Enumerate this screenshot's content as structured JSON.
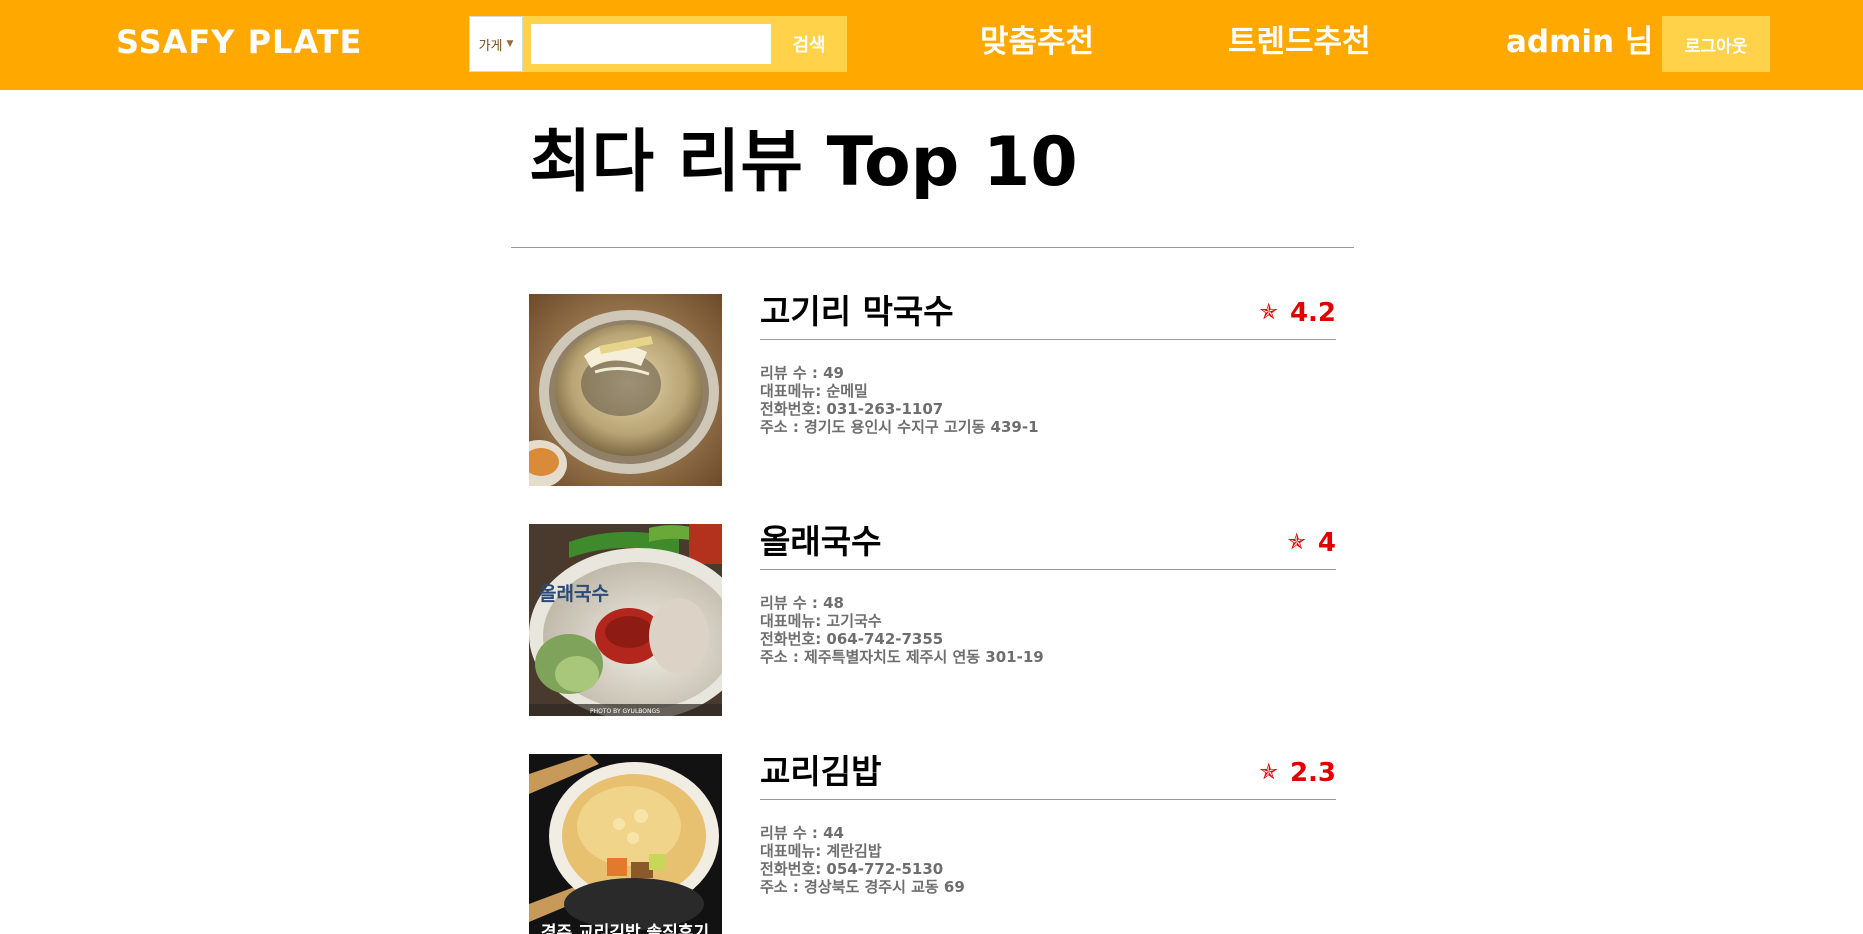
{
  "header": {
    "brand": "SSAFY PLATE",
    "search": {
      "category": "가게",
      "value": "",
      "button": "검색"
    },
    "nav": {
      "custom": "맞춤추천",
      "trend": "트렌드추천"
    },
    "user_greeting": "admin 님",
    "logout": "로그아웃",
    "colors": {
      "bar": "#ffa800",
      "accent": "#ffd24a"
    }
  },
  "main": {
    "title": "최다 리뷰 Top 10",
    "restaurants": [
      {
        "name": "고기리 막국수",
        "rating": "4.2",
        "reviews": "리뷰 수 : 49",
        "menu": "대표메뉴: 순메밀",
        "phone": "전화번호: 031-263-1107",
        "address": "주소 : 경기도 용인시 수지구 고기동 439-1"
      },
      {
        "name": "올래국수",
        "rating": "4",
        "reviews": "리뷰 수 : 48",
        "menu": "대표메뉴: 고기국수",
        "phone": "전화번호: 064-742-7355",
        "address": "주소 : 제주특별자치도 제주시 연동 301-19",
        "photo_text": {
          "logo": "올래국수",
          "credit": "PHOTO BY GYULBONGS"
        }
      },
      {
        "name": "교리김밥",
        "rating": "2.3",
        "reviews": "리뷰 수 : 44",
        "menu": "대표메뉴: 계란김밥",
        "phone": "전화번호: 054-772-5130",
        "address": "주소 : 경상북도 경주시 교동 69",
        "photo_text": {
          "caption": "경주 교리김밥 솔직후기"
        }
      }
    ],
    "rating_icon": "star-icon",
    "rating_color": "#e00000"
  }
}
